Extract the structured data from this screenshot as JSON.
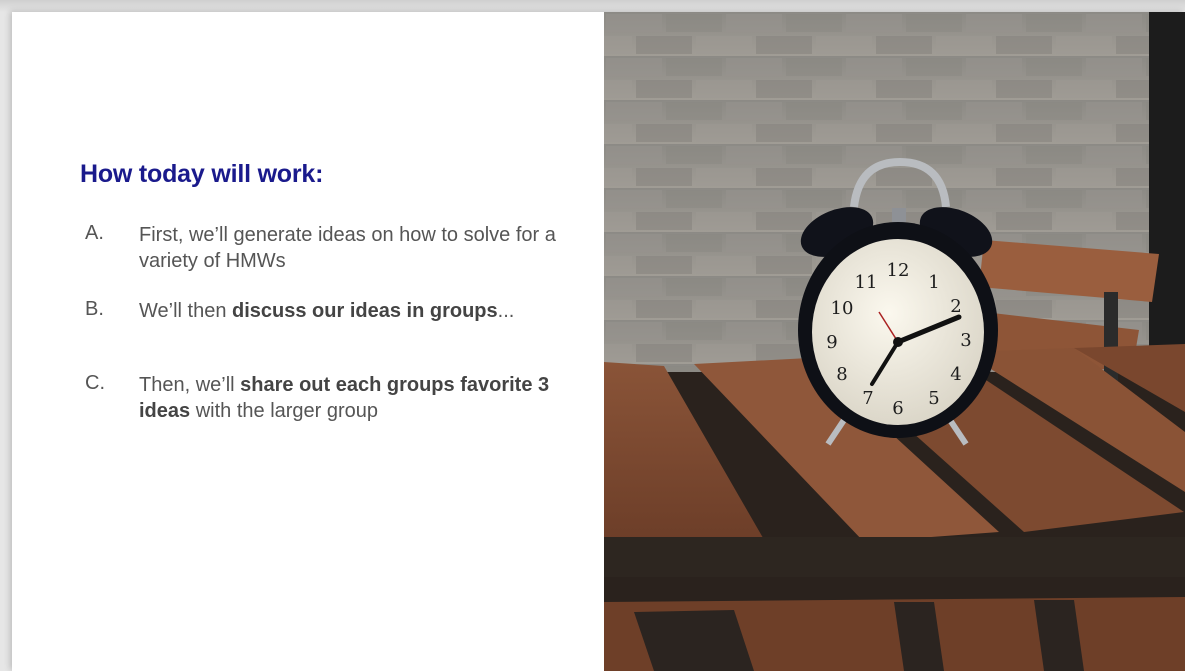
{
  "slide": {
    "heading": "How today will work:",
    "steps": [
      {
        "letter": "A.",
        "parts": [
          "First, we’ll generate ideas on how to solve for a variety of HMWs"
        ]
      },
      {
        "letter": "B.",
        "parts": [
          "We’ll then ",
          "discuss our ideas in groups",
          "..."
        ]
      },
      {
        "letter": "C.",
        "parts": [
          "Then, we’ll ",
          "share out each groups favorite 3 ideas",
          " with the larger group"
        ]
      }
    ],
    "photo": {
      "subject": "alarm-clock-on-wooden-table",
      "clock_numbers": [
        "12",
        "1",
        "2",
        "3",
        "4",
        "5",
        "6",
        "7",
        "8",
        "9",
        "10",
        "11"
      ]
    },
    "colors": {
      "heading": "#1a1a8c",
      "body_text": "#555555",
      "slide_background": "#ffffff"
    }
  }
}
